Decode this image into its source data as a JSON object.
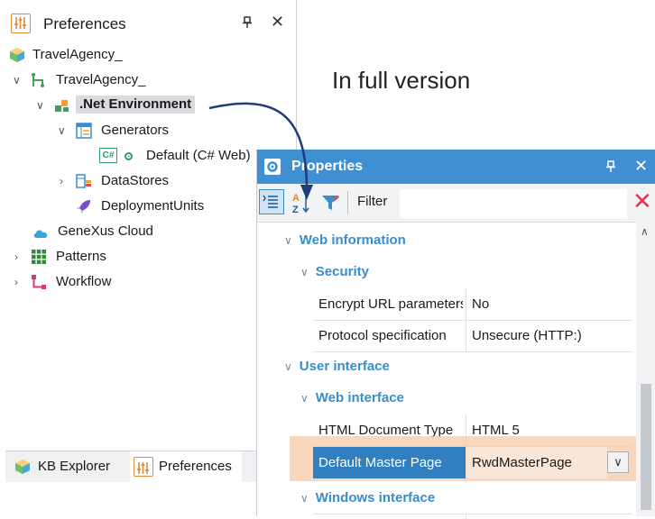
{
  "preferences": {
    "title": "Preferences",
    "pin_glyph": "❖",
    "close_glyph": "✕",
    "tree": [
      {
        "label": "TravelAgency_",
        "icon": "kb-cube-icon"
      },
      {
        "label": "TravelAgency_",
        "icon": "version-tree-icon"
      },
      {
        "label": ".Net Environment",
        "icon": "environment-icon"
      },
      {
        "label": "Generators",
        "icon": "generators-icon"
      },
      {
        "label": "Default (C# Web)",
        "icon": "csharp-generator-icon",
        "badge": "C#"
      },
      {
        "label": "DataStores",
        "icon": "datastores-icon"
      },
      {
        "label": "DeploymentUnits",
        "icon": "rocket-icon"
      },
      {
        "label": "GeneXus Cloud",
        "icon": "cloud-icon"
      },
      {
        "label": "Patterns",
        "icon": "patterns-grid-icon"
      },
      {
        "label": "Workflow",
        "icon": "workflow-icon"
      }
    ],
    "tabs": [
      {
        "label": "KB Explorer",
        "icon": "kb-cube-icon"
      },
      {
        "label": "Preferences",
        "icon": "preferences-icon"
      }
    ]
  },
  "annotation": {
    "text": "In full version"
  },
  "properties": {
    "title": "Properties",
    "filter_label": "Filter",
    "filter_value": "",
    "sections": {
      "web_information": "Web information",
      "security": "Security",
      "user_interface": "User interface",
      "web_interface": "Web interface",
      "windows_interface": "Windows interface"
    },
    "rows": {
      "encrypt_url": {
        "name": "Encrypt URL parameters",
        "value": "No"
      },
      "protocol": {
        "name": "Protocol specification",
        "value": "Unsecure (HTTP:)"
      },
      "html_doc": {
        "name": "HTML Document Type",
        "value": "HTML 5"
      },
      "master_page": {
        "name": "Default Master Page",
        "value": "RwdMasterPage"
      }
    }
  },
  "colors": {
    "accent_blue": "#3f8fd3",
    "selected_row": "#2f7fc1",
    "highlight_orange": "#f5c9a6",
    "arrow": "#1f3d7a",
    "section_text": "#3a8dc9"
  }
}
